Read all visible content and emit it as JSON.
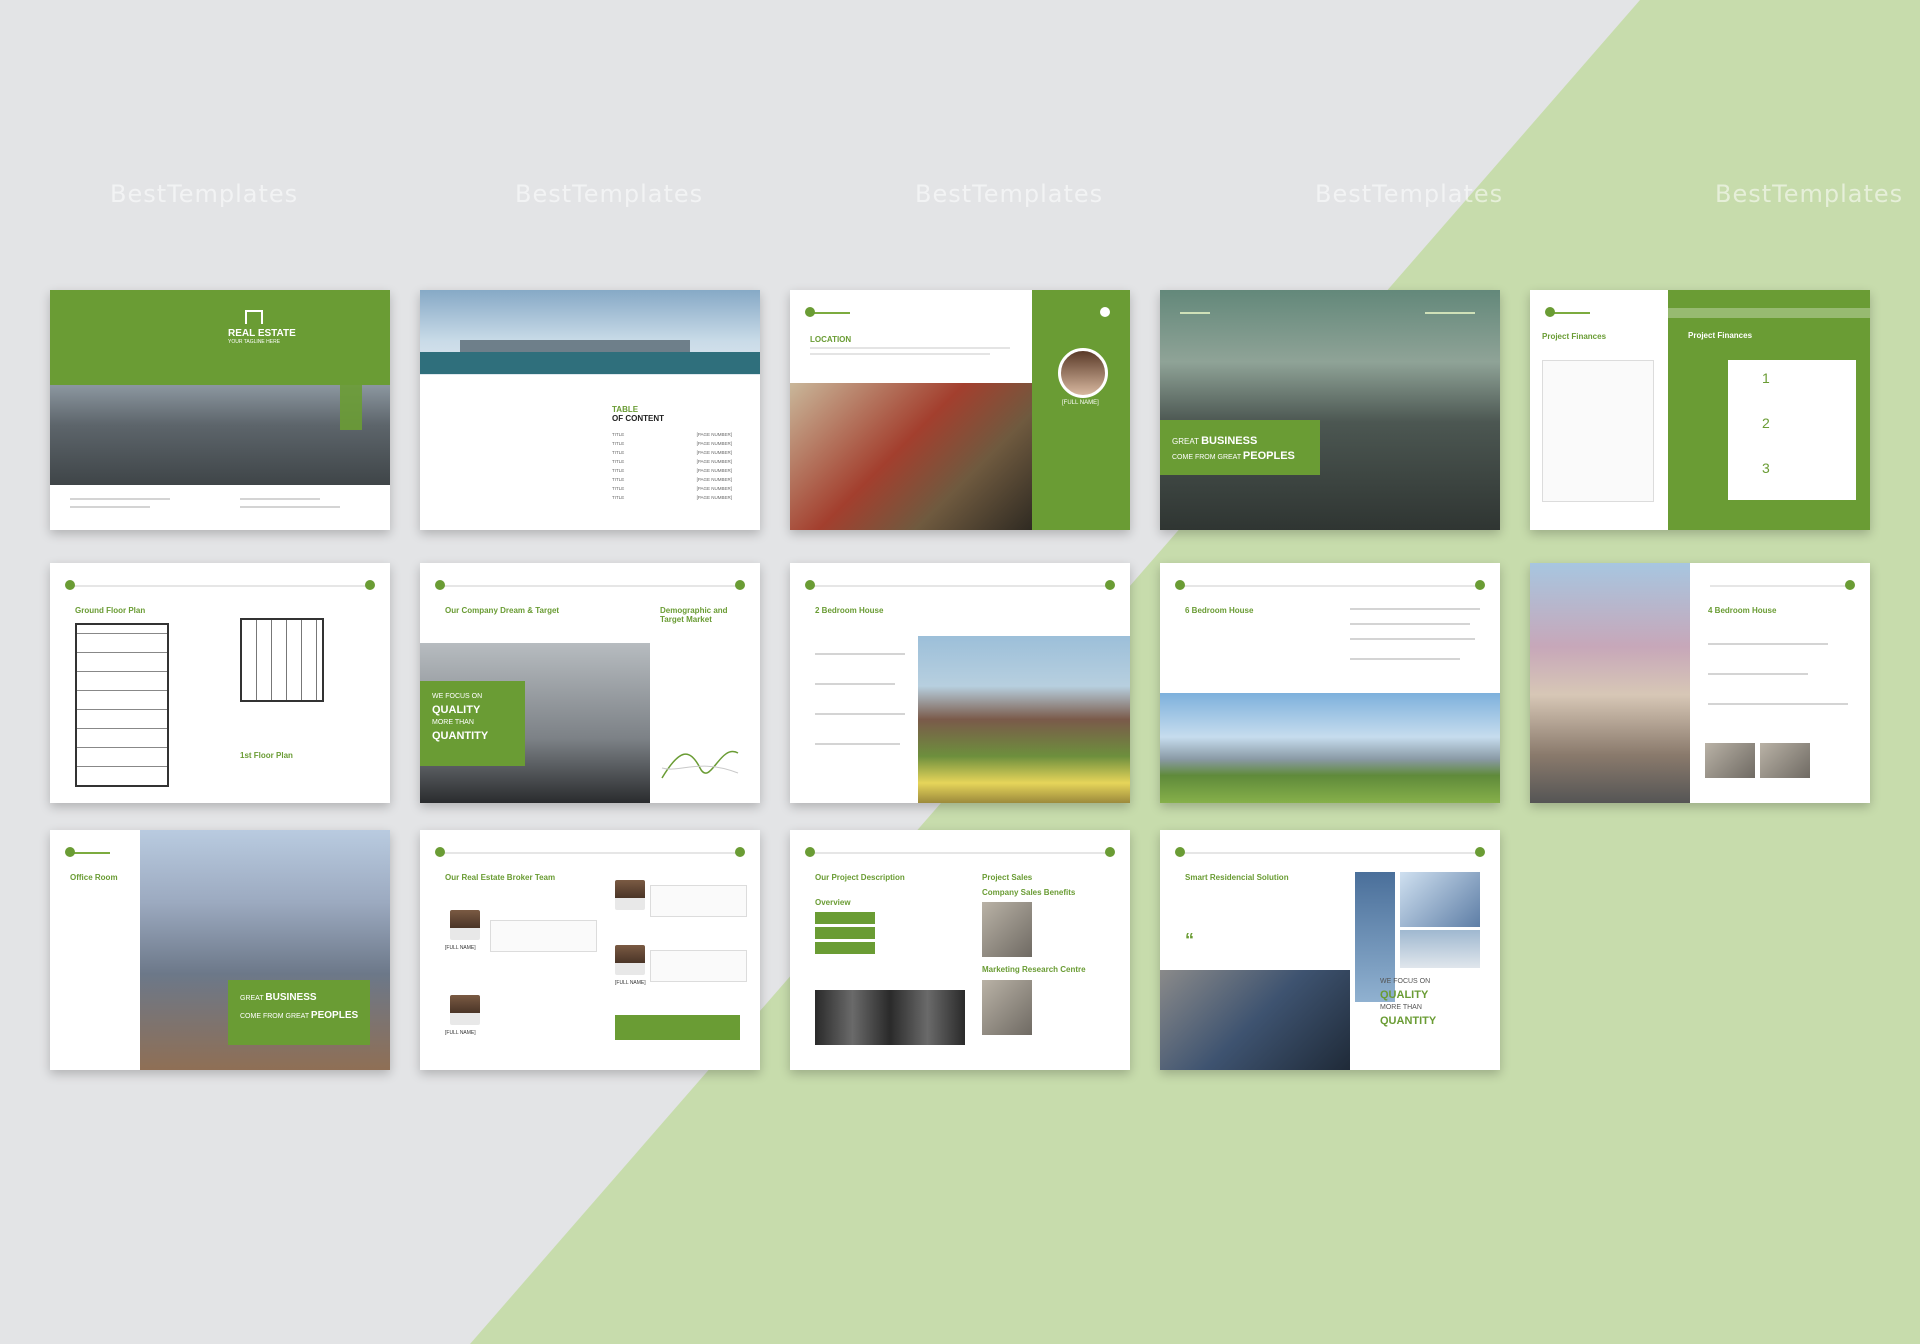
{
  "colors": {
    "accent": "#6a9c34",
    "light_bg": "#e3e4e6",
    "diagonal": "#c7dcac"
  },
  "watermark": "BestTemplates",
  "pages": {
    "cover": {
      "title": "REAL ESTATE",
      "subtitle": "YOUR TAGLINE HERE"
    },
    "toc": {
      "title_line1": "TABLE",
      "title_line2": "OF CONTENT",
      "entries": [
        "TITLE",
        "TITLE",
        "TITLE",
        "TITLE",
        "TITLE",
        "TITLE",
        "TITLE",
        "TITLE"
      ],
      "page_label": "[PAGE NUMBER]"
    },
    "location": {
      "heading": "LOCATION",
      "name": "[FULL NAME]"
    },
    "great_business": {
      "line1_a": "GREAT",
      "line1_b": "BUSINESS",
      "line2_a": "COME FROM GREAT",
      "line2_b": "PEOPLES"
    },
    "finances": {
      "heading_left": "Project Finances",
      "heading_right": "Project Finances",
      "steps": [
        "1",
        "2",
        "3"
      ]
    },
    "floor_plan": {
      "heading": "Ground Floor Plan",
      "heading2": "1st Floor Plan"
    },
    "dream": {
      "heading": "Our Company Dream & Target",
      "heading2": "Demographic and Target Market",
      "focus_a": "WE FOCUS ON",
      "focus_b": "QUALITY",
      "focus_c": "MORE THAN",
      "focus_d": "QUANTITY"
    },
    "two_bedroom": {
      "heading": "2 Bedroom House"
    },
    "six_bedroom": {
      "heading": "6 Bedroom House"
    },
    "four_bedroom": {
      "heading": "4 Bedroom House"
    },
    "office": {
      "heading": "Office Room",
      "banner_a": "GREAT",
      "banner_b": "BUSINESS",
      "banner_c": "COME FROM GREAT",
      "banner_d": "PEOPLES"
    },
    "broker": {
      "heading": "Our Real Estate Broker Team",
      "names": [
        "[FULL NAME]",
        "[FULL NAME]",
        "[FULL NAME]"
      ]
    },
    "project_desc": {
      "heading": "Our Project Description",
      "heading2": "Project Sales",
      "heading3": "Company Sales Benefits",
      "heading4": "Marketing Research Centre",
      "overview": "Overview"
    },
    "smart": {
      "heading": "Smart Residencial Solution",
      "focus_a": "WE FOCUS ON",
      "focus_b": "QUALITY",
      "focus_c": "MORE THAN",
      "focus_d": "QUANTITY"
    }
  }
}
